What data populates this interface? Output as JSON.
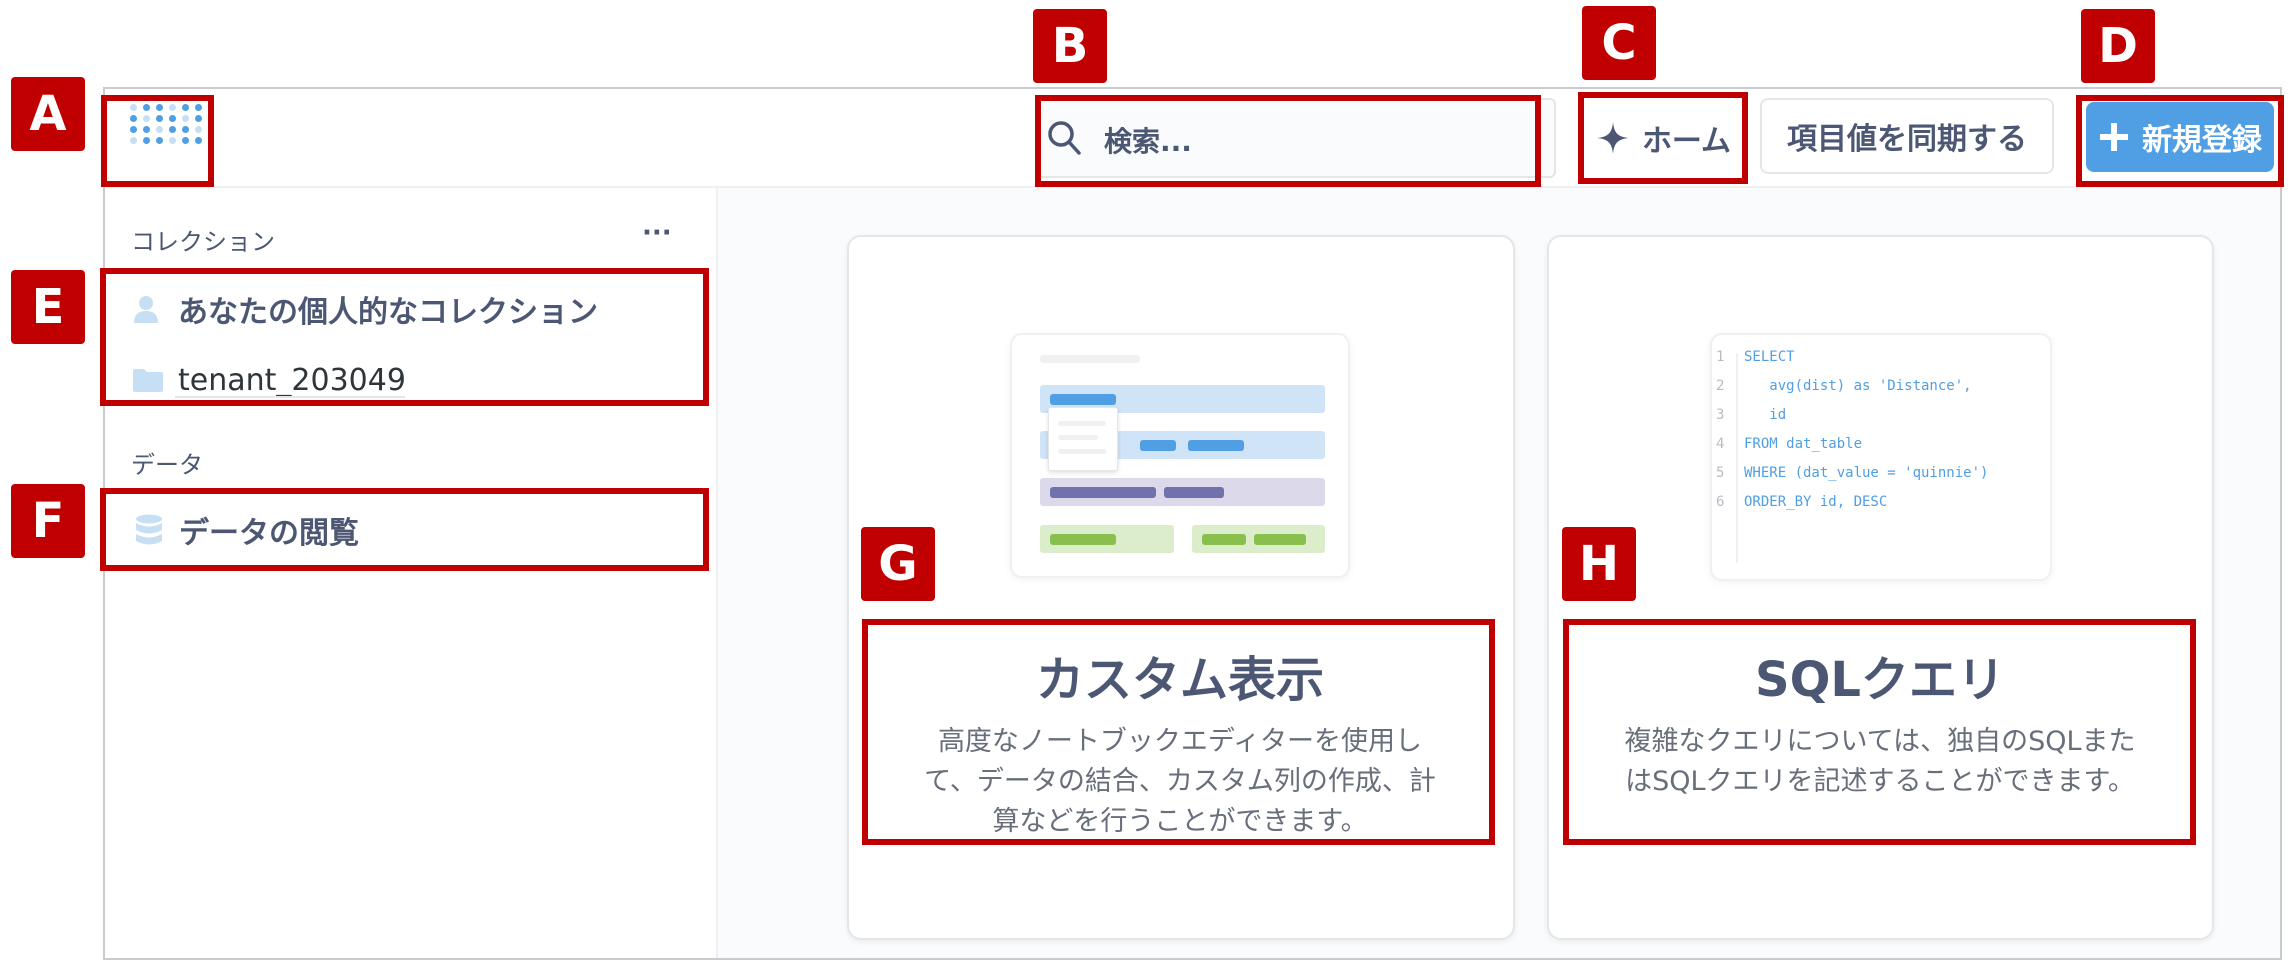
{
  "labels": {
    "a": "A",
    "b": "B",
    "c": "C",
    "d": "D",
    "e": "E",
    "f": "F",
    "g": "G",
    "h": "H"
  },
  "header": {
    "search_placeholder": "検索...",
    "home_label": "ホーム",
    "sync_label": "項目値を同期する",
    "new_label": "新規登録"
  },
  "sidebar": {
    "collections_heading": "コレクション",
    "more_label": "···",
    "personal_collection": "あなたの個人的なコレクション",
    "tenant_collection": "tenant_203049",
    "data_heading": "データ",
    "browse_data": "データの閲覧"
  },
  "cards": {
    "custom": {
      "title": "カスタム表示",
      "desc_line1": "高度なノートブックエディターを使用し",
      "desc_line2": "て、データの結合、カスタム列の作成、計",
      "desc_line3": "算などを行うことができます。"
    },
    "sql": {
      "title": "SQLクエリ",
      "desc_line1": "複雑なクエリについては、独自のSQLまた",
      "desc_line2": "はSQLクエリを記述することができます。",
      "code": [
        {
          "n": "1",
          "text": "SELECT"
        },
        {
          "n": "2",
          "text": "   avg(dist) as 'Distance',"
        },
        {
          "n": "3",
          "text": "   id"
        },
        {
          "n": "4",
          "text": "FROM dat_table"
        },
        {
          "n": "5",
          "text": "WHERE (dat_value = 'quinnie')"
        },
        {
          "n": "6",
          "text": "ORDER_BY id, DESC"
        }
      ]
    }
  },
  "colors": {
    "accent": "#509ee3",
    "callout": "#c00000"
  }
}
